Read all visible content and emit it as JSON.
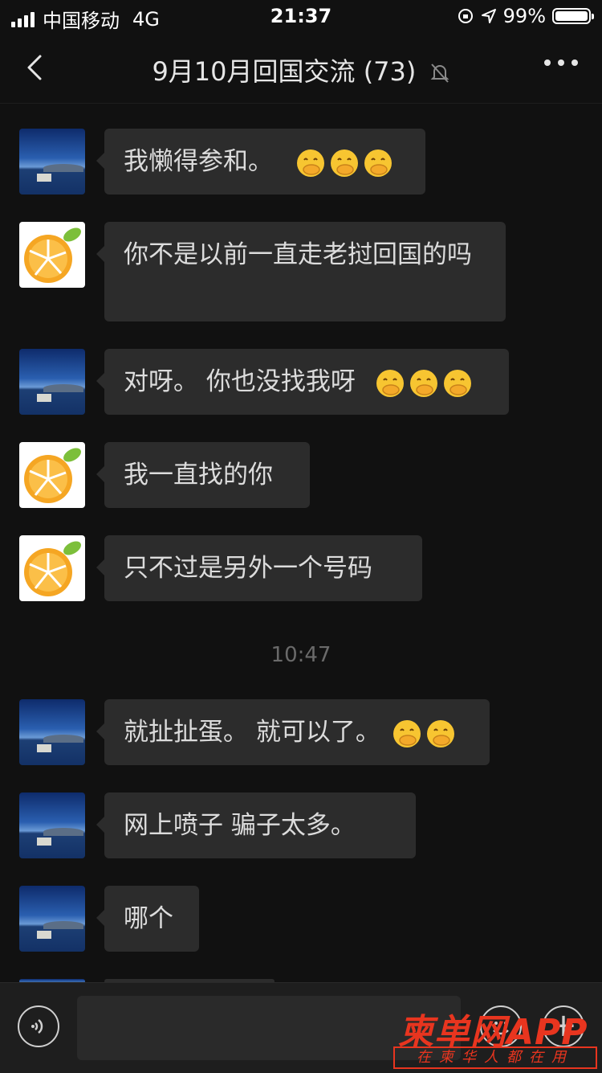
{
  "status_bar": {
    "carrier": "中国移动",
    "network": "4G",
    "time": "21:37",
    "battery_text": "99%",
    "battery_level": 0.99
  },
  "nav": {
    "title": "9月10月回国交流 (73)",
    "back_icon": "chevron-left-icon",
    "mute_icon": "bell-muted-icon",
    "more_icon": "more-dots-icon"
  },
  "messages": [
    {
      "avatar": "sea",
      "text": "我懒得参和。",
      "emoji_count": 3
    },
    {
      "avatar": "orange",
      "text": "你不是以前一直走老挝回国的吗",
      "emoji_count": 0
    },
    {
      "avatar": "sea",
      "text": "对呀。 你也没找我呀",
      "emoji_count": 3
    },
    {
      "avatar": "orange",
      "text": "我一直找的你",
      "emoji_count": 0
    },
    {
      "avatar": "orange",
      "text": "只不过是另外一个号码",
      "emoji_count": 0
    },
    {
      "avatar": "sea",
      "text": "就扯扯蛋。 就可以了。",
      "emoji_count": 2
    },
    {
      "avatar": "sea",
      "text": "网上喷子 骗子太多。",
      "emoji_count": 0
    },
    {
      "avatar": "sea",
      "text": "哪个",
      "emoji_count": 0
    }
  ],
  "timestamp": "10:47",
  "emoji_name": "hand-over-mouth-emoji",
  "input_bar": {
    "voice_icon": "voice-icon",
    "emoji_icon": "smiley-icon",
    "plus_icon": "plus-icon"
  },
  "watermark": {
    "brand": "柬单网APP",
    "tagline": "在柬华人都在用"
  }
}
